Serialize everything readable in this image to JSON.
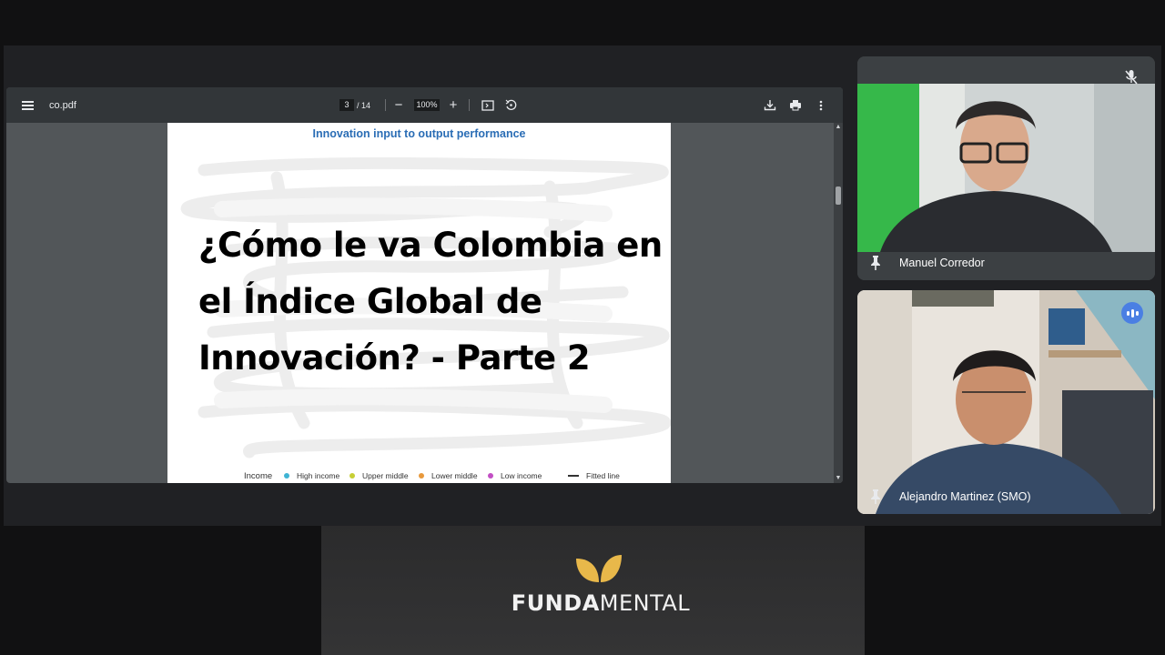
{
  "pdf": {
    "file_name": "co.pdf",
    "current_page": "3",
    "total_pages": "/ 14",
    "zoom": "100%",
    "zoom_out_label": "−",
    "zoom_in_label": "+",
    "icons": [
      "menu-icon",
      "fit-page-icon",
      "rotate-icon",
      "download-icon",
      "print-icon",
      "more-vert-icon"
    ]
  },
  "slide": {
    "title": "Innovation input to output performance",
    "overlay_title": "¿Cómo le va Colombia en el Índice Global de Innovación? - Parte 2",
    "legend": {
      "title": "Income",
      "items": [
        {
          "label": "High income",
          "color": "#3fb4d4"
        },
        {
          "label": "Upper middle",
          "color": "#c7cf35"
        },
        {
          "label": "Lower middle",
          "color": "#e8993c"
        },
        {
          "label": "Low income",
          "color": "#c24fc4"
        },
        {
          "label": "Fitted line",
          "color": "#333333"
        }
      ]
    }
  },
  "participants": [
    {
      "name": "Manuel Corredor",
      "status_icon": "mic-off-icon"
    },
    {
      "name": "Alejandro Martinez (SMO)",
      "status_icon": "speaking-icon"
    }
  ],
  "brand": {
    "name_bold": "FUNDA",
    "name_light": "MENTAL",
    "accent_color": "#e8b84a"
  }
}
